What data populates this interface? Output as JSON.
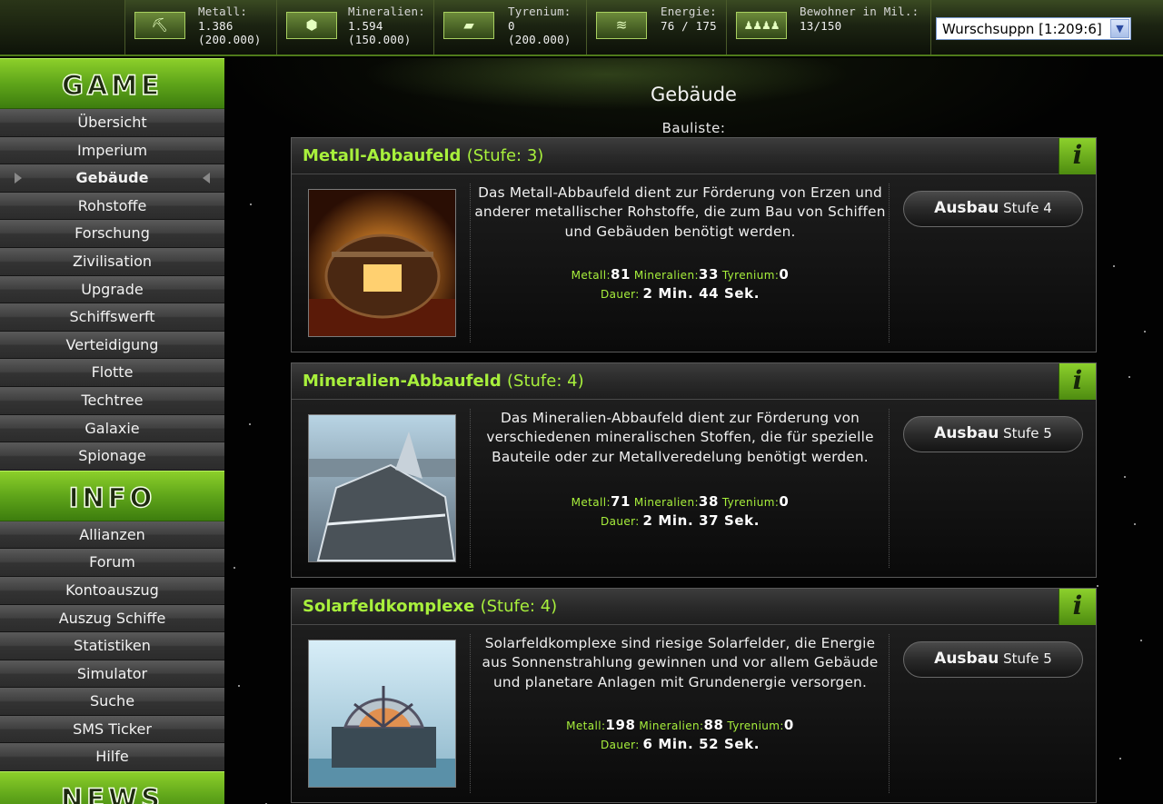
{
  "resources": [
    {
      "id": "metal",
      "label": "Metall:",
      "value": "1.386",
      "cap": "(200.000)",
      "icon": "metal-icon",
      "glyph": "⛏"
    },
    {
      "id": "minerals",
      "label": "Mineralien:",
      "value": "1.594",
      "cap": "(150.000)",
      "icon": "minerals-icon",
      "glyph": "⬢"
    },
    {
      "id": "tyrenium",
      "label": "Tyrenium:",
      "value": "0",
      "cap": "(200.000)",
      "icon": "tyrenium-icon",
      "glyph": "▰"
    },
    {
      "id": "energy",
      "label": "Energie:",
      "value": "76 / 175",
      "cap": "",
      "icon": "energy-icon",
      "glyph": "≋"
    },
    {
      "id": "population",
      "label": "Bewohner in Mil.:",
      "value": "13/150",
      "cap": "",
      "icon": "population-icon",
      "glyph": "♟♟♟♟"
    }
  ],
  "planet_select": {
    "value": "Wurschsuppn [1:209:6]"
  },
  "sidebar": {
    "sections": [
      {
        "title": "GAME",
        "items": [
          "Übersicht",
          "Imperium",
          "Gebäude",
          "Rohstoffe",
          "Forschung",
          "Zivilisation",
          "Upgrade",
          "Schiffswerft",
          "Verteidigung",
          "Flotte",
          "Techtree",
          "Galaxie",
          "Spionage"
        ]
      },
      {
        "title": "INFO",
        "items": [
          "Allianzen",
          "Forum",
          "Kontoauszug",
          "Auszug Schiffe",
          "Statistiken",
          "Simulator",
          "Suche",
          "SMS Ticker",
          "Hilfe"
        ]
      },
      {
        "title": "NEWS",
        "items": []
      }
    ],
    "active": "Gebäude"
  },
  "main": {
    "title": "Gebäude",
    "build_list_label": "Bauliste:",
    "cost_labels": {
      "metal": "Metall:",
      "minerals": "Mineralien:",
      "tyrenium": "Tyrenium:",
      "duration": "Dauer:"
    },
    "info_glyph": "i",
    "buildings": [
      {
        "name": "Metall-Abbaufeld",
        "level": "(Stufe: 3)",
        "description": "Das Metall-Abbaufeld dient zur Förderung von Erzen und anderer metallischer Rohstoffe, die zum Bau von Schiffen und Gebäuden benötigt werden.",
        "metal": "81",
        "minerals": "33",
        "tyrenium": "0",
        "duration": "2 Min. 44 Sek.",
        "upgrade_word": "Ausbau",
        "upgrade_level": "Stufe 4"
      },
      {
        "name": "Mineralien-Abbaufeld",
        "level": "(Stufe: 4)",
        "description": "Das Mineralien-Abbaufeld dient zur Förderung von verschiedenen mineralischen Stoffen, die für spezielle Bauteile oder zur Metallveredelung benötigt werden.",
        "metal": "71",
        "minerals": "38",
        "tyrenium": "0",
        "duration": "2 Min. 37 Sek.",
        "upgrade_word": "Ausbau",
        "upgrade_level": "Stufe 5"
      },
      {
        "name": "Solarfeldkomplexe",
        "level": "(Stufe: 4)",
        "description": "Solarfeldkomplexe sind riesige Solarfelder, die Energie aus Sonnenstrahlung gewinnen und vor allem Gebäude und planetare Anlagen mit Grundenergie versorgen.",
        "metal": "198",
        "minerals": "88",
        "tyrenium": "0",
        "duration": "6 Min. 52 Sek.",
        "upgrade_word": "Ausbau",
        "upgrade_level": "Stufe 5"
      }
    ]
  }
}
